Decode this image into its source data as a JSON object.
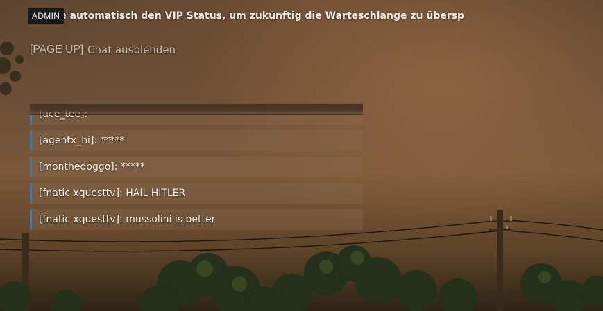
{
  "announcement": {
    "badge": "ADMIN",
    "text": "e automatisch den VIP Status, um zukünftig die Warteschlange zu übersp"
  },
  "chat_toggle": {
    "key": "[PAGE UP]",
    "label": "Chat ausblenden"
  },
  "chat": {
    "messages": [
      {
        "text": "[ace_tee]:"
      },
      {
        "text": "[agentx_hi]: *****"
      },
      {
        "text": "[monthedoggo]: *****"
      },
      {
        "text": "[fnatic xquesttv]: HAIL HITLER"
      },
      {
        "text": "[fnatic xquesttv]: mussolini is better"
      }
    ]
  },
  "colors": {
    "accent": "#3d79b4",
    "badge_bg": "#1a1a1a"
  }
}
